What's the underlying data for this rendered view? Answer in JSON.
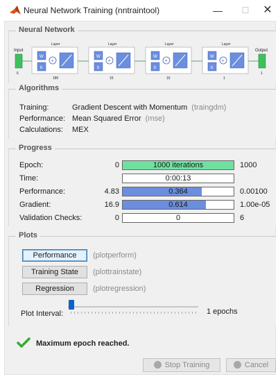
{
  "window": {
    "title": "Neural Network Training (nntraintool)",
    "minimize": "—",
    "maximize": "☐",
    "close": "✕"
  },
  "network": {
    "section_title": "Neural Network",
    "input_label": "Input",
    "input_size": "6",
    "output_label": "Output",
    "output_size": "1",
    "layers": [
      {
        "title": "Layer",
        "w": "W",
        "b": "b",
        "size": "180"
      },
      {
        "title": "Layer",
        "w": "W",
        "b": "b",
        "size": "15"
      },
      {
        "title": "Layer",
        "w": "W",
        "b": "b",
        "size": "15"
      },
      {
        "title": "Layer",
        "w": "W",
        "b": "b",
        "size": "1"
      }
    ]
  },
  "algorithms": {
    "section_title": "Algorithms",
    "rows": [
      {
        "key": "Training:",
        "value": "Gradient Descent with Momentum",
        "fn": "(traingdm)"
      },
      {
        "key": "Performance:",
        "value": "Mean Squared Error",
        "fn": "(mse)"
      },
      {
        "key": "Calculations:",
        "value": "MEX",
        "fn": ""
      }
    ]
  },
  "progress": {
    "section_title": "Progress",
    "rows": [
      {
        "label": "Epoch:",
        "start": "0",
        "value": "1000 iterations",
        "end": "1000",
        "fill": 1.0,
        "color": "#70e0a0"
      },
      {
        "label": "Time:",
        "start": "",
        "value": "0:00:13",
        "end": "",
        "fill": 0,
        "color": "#ffffff"
      },
      {
        "label": "Performance:",
        "start": "4.83",
        "value": "0.364",
        "end": "0.00100",
        "fill": 0.71,
        "color": "#6b8ede"
      },
      {
        "label": "Gradient:",
        "start": "16.9",
        "value": "0.614",
        "end": "1.00e-05",
        "fill": 0.75,
        "color": "#6b8ede"
      },
      {
        "label": "Validation Checks:",
        "start": "0",
        "value": "0",
        "end": "6",
        "fill": 0,
        "color": "#ffffff"
      }
    ]
  },
  "plots": {
    "section_title": "Plots",
    "buttons": [
      {
        "label": "Performance",
        "fn": "(plotperform)"
      },
      {
        "label": "Training State",
        "fn": "(plottrainstate)"
      },
      {
        "label": "Regression",
        "fn": "(plotregression)"
      }
    ],
    "interval_label": "Plot Interval:",
    "interval_value": "1 epochs",
    "interval_level": 0
  },
  "status": {
    "message": "Maximum epoch reached.",
    "check_color": "#3aa935"
  },
  "footer": {
    "stop_label": "Stop Training",
    "cancel_label": "Cancel"
  }
}
